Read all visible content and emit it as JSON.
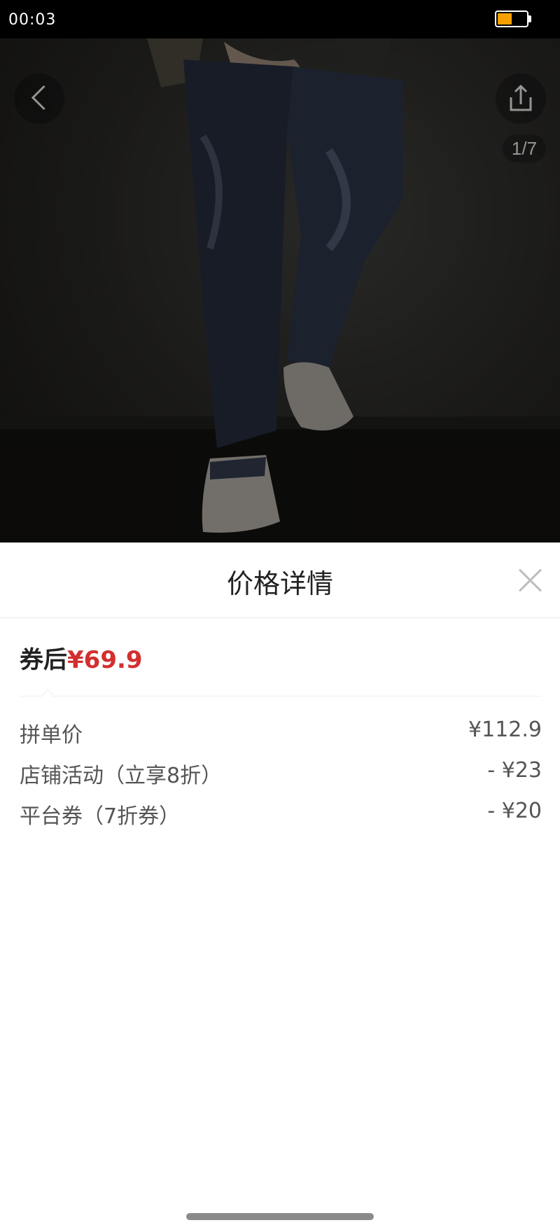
{
  "status_bar": {
    "time": "00:03",
    "battery_color": "#f5a000"
  },
  "hero": {
    "page_counter": "1/7",
    "back_icon": "chevron-left-icon",
    "share_icon": "share-icon"
  },
  "sheet": {
    "title": "价格详情",
    "close_icon": "close-icon",
    "final_price": {
      "label": "券后",
      "value": "¥69.9",
      "value_color": "#d32f2f"
    },
    "rows": [
      {
        "label": "拼单价",
        "amount": "¥112.9"
      },
      {
        "label": "店铺活动（立享8折）",
        "amount": "- ¥23"
      },
      {
        "label": "平台券（7折券）",
        "amount": "- ¥20"
      }
    ]
  }
}
